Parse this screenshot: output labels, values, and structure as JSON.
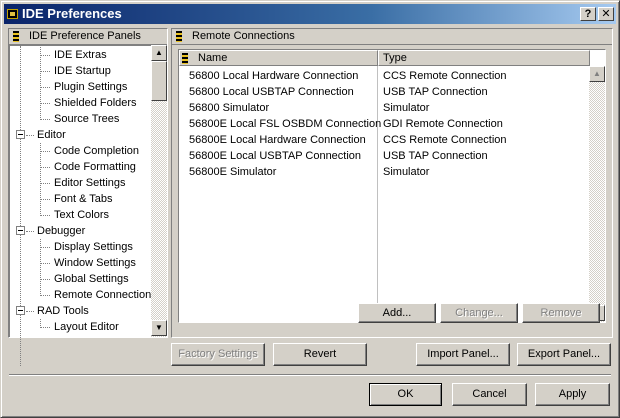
{
  "window": {
    "title": "IDE Preferences",
    "help_glyph": "?",
    "close_glyph": "✕"
  },
  "left_panel": {
    "header": "IDE Preference Panels",
    "items": [
      {
        "label": "IDE Extras",
        "level": "child"
      },
      {
        "label": "IDE Startup",
        "level": "child"
      },
      {
        "label": "Plugin Settings",
        "level": "child"
      },
      {
        "label": "Shielded Folders",
        "level": "child"
      },
      {
        "label": "Source Trees",
        "level": "child"
      },
      {
        "label": "Editor",
        "level": "root"
      },
      {
        "label": "Code Completion",
        "level": "child"
      },
      {
        "label": "Code Formatting",
        "level": "child"
      },
      {
        "label": "Editor Settings",
        "level": "child"
      },
      {
        "label": "Font & Tabs",
        "level": "child"
      },
      {
        "label": "Text Colors",
        "level": "child"
      },
      {
        "label": "Debugger",
        "level": "root"
      },
      {
        "label": "Display Settings",
        "level": "child"
      },
      {
        "label": "Window Settings",
        "level": "child"
      },
      {
        "label": "Global Settings",
        "level": "child"
      },
      {
        "label": "Remote Connections",
        "level": "child"
      },
      {
        "label": "RAD Tools",
        "level": "root"
      },
      {
        "label": "Layout Editor",
        "level": "child"
      }
    ]
  },
  "right_panel": {
    "header": "Remote Connections",
    "columns": {
      "name": "Name",
      "type": "Type"
    },
    "rows": [
      {
        "name": "56800 Local Hardware Connection",
        "type": "CCS Remote Connection"
      },
      {
        "name": "56800 Local USBTAP Connection",
        "type": "USB TAP Connection"
      },
      {
        "name": "56800 Simulator",
        "type": "Simulator"
      },
      {
        "name": "56800E Local FSL OSBDM Connection",
        "type": "GDI Remote Connection"
      },
      {
        "name": "56800E Local Hardware Connection",
        "type": "CCS Remote Connection"
      },
      {
        "name": "56800E Local USBTAP Connection",
        "type": "USB TAP Connection"
      },
      {
        "name": "56800E Simulator",
        "type": "Simulator"
      }
    ],
    "buttons": {
      "add": "Add...",
      "change": "Change...",
      "remove": "Remove"
    }
  },
  "middle_buttons": {
    "factory": "Factory Settings",
    "revert": "Revert",
    "import": "Import Panel...",
    "export": "Export Panel..."
  },
  "footer_buttons": {
    "ok": "OK",
    "cancel": "Cancel",
    "apply": "Apply"
  }
}
